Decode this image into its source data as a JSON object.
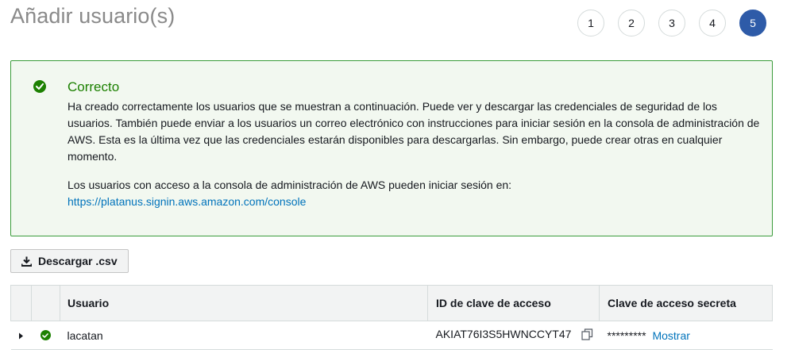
{
  "header": {
    "title": "Añadir usuario(s)",
    "steps": [
      {
        "label": "1",
        "active": false
      },
      {
        "label": "2",
        "active": false
      },
      {
        "label": "3",
        "active": false
      },
      {
        "label": "4",
        "active": false
      },
      {
        "label": "5",
        "active": true
      }
    ],
    "accent_color": "#2e5ba8"
  },
  "alert": {
    "icon": "check-circle-icon",
    "title": "Correcto",
    "message": "Ha creado correctamente los usuarios que se muestran a continuación. Puede ver y descargar las credenciales de seguridad de los usuarios. También puede enviar a los usuarios un correo electrónico con instrucciones para iniciar sesión en la consola de administración de AWS. Esta es la última vez que las credenciales estarán disponibles para descargarlas. Sin embargo, puede crear otras en cualquier momento.",
    "signin_text": "Los usuarios con acceso a la consola de administración de AWS pueden iniciar sesión en:",
    "signin_link": "https://platanus.signin.aws.amazon.com/console",
    "success_color": "#1d8102",
    "border_color": "#3a9c3b",
    "background_color": "#f2f8f0"
  },
  "download_button": {
    "icon": "download-icon",
    "label": "Descargar .csv"
  },
  "table": {
    "columns": [
      "",
      "",
      "Usuario",
      "ID de clave de acceso",
      "Clave de acceso secreta"
    ],
    "rows": [
      {
        "user": "lacatan",
        "access_key_id": "AKIAT76I3S5HWNCCYT47",
        "secret_key_masked": "*********",
        "show_label": "Mostrar",
        "status": "success"
      }
    ]
  },
  "link_color": "#0073bb"
}
